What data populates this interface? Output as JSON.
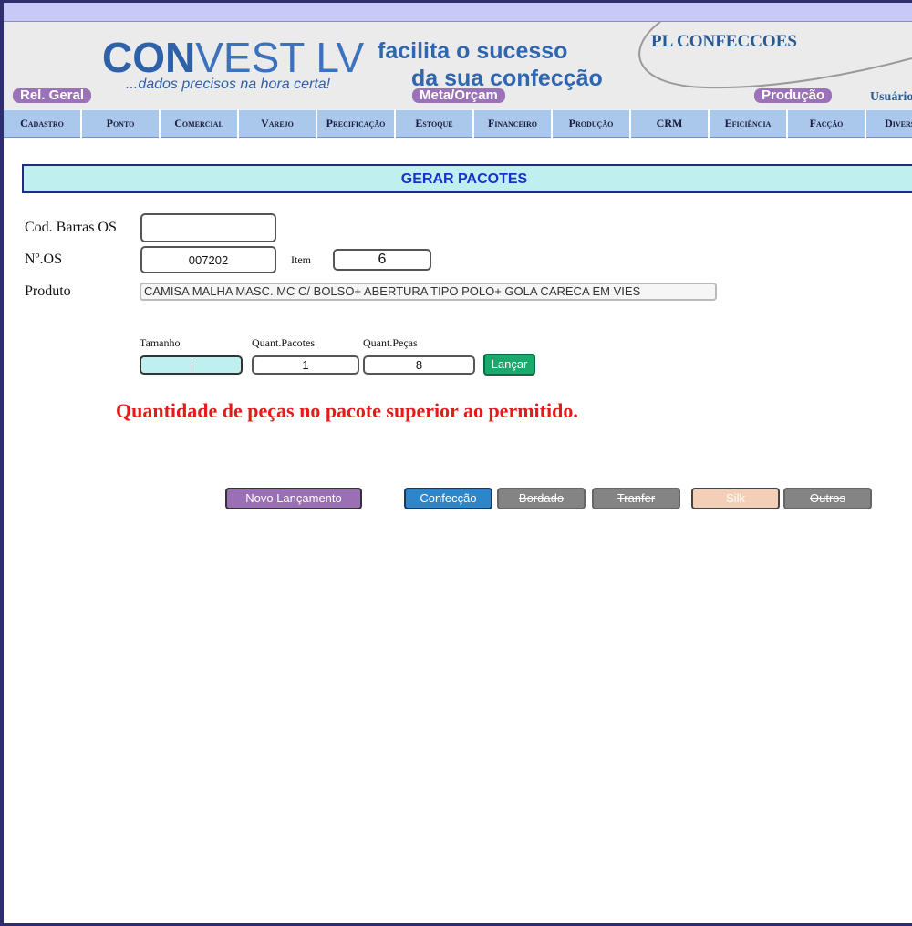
{
  "header": {
    "logo_bold": "CON",
    "logo_light": "VEST LV",
    "logo_tagline": "...dados precisos na hora certa!",
    "slogan_line1": "facilita o sucesso",
    "slogan_line2": "da sua confecção",
    "company": "PL CONFECCOES",
    "pill_rel": "Rel. Geral",
    "pill_meta": "Meta/Orçam",
    "pill_prod": "Produção",
    "user_label": "Usuário"
  },
  "nav": {
    "items": [
      "Cadastro",
      "Ponto",
      "Comercial",
      "Varejo",
      "Precificação",
      "Estoque",
      "Financeiro",
      "Produção",
      "CRM",
      "Eficiência",
      "Facção",
      "Diversos"
    ]
  },
  "panel": {
    "title": "GERAR PACOTES"
  },
  "form": {
    "cod_barras_label": "Cod. Barras OS",
    "cod_barras_value": "",
    "nos_label": "Nº.OS",
    "nos_value": "007202",
    "item_label": "Item",
    "item_value": "6",
    "produto_label": "Produto",
    "produto_value": "CAMISA MALHA MASC. MC C/ BOLSO+ ABERTURA TIPO POLO+ GOLA CARECA EM VIES",
    "tamanho_label": "Tamanho",
    "tamanho_value": "",
    "quant_pacotes_label": "Quant.Pacotes",
    "quant_pacotes_value": "1",
    "quant_pecas_label": "Quant.Peças",
    "quant_pecas_value": "8",
    "lancar_label": "Lançar"
  },
  "message": {
    "error": "Quantidade de peças no pacote superior ao permitido."
  },
  "actions": {
    "novo": "Novo Lançamento",
    "confeccao": "Confecção",
    "bordado": "Bordado",
    "tranfer": "Tranfer",
    "silk": "Silk",
    "outros": "Outros"
  },
  "colors": {
    "nav_bg": "#a9c8ec",
    "panel_bg": "#c0efef",
    "error": "#e41b1b",
    "lancar": "#1aa86c",
    "confeccao": "#2d86c9",
    "novo": "#9b6fb3",
    "silk": "#f2cfb6",
    "disabled": "#848484"
  }
}
